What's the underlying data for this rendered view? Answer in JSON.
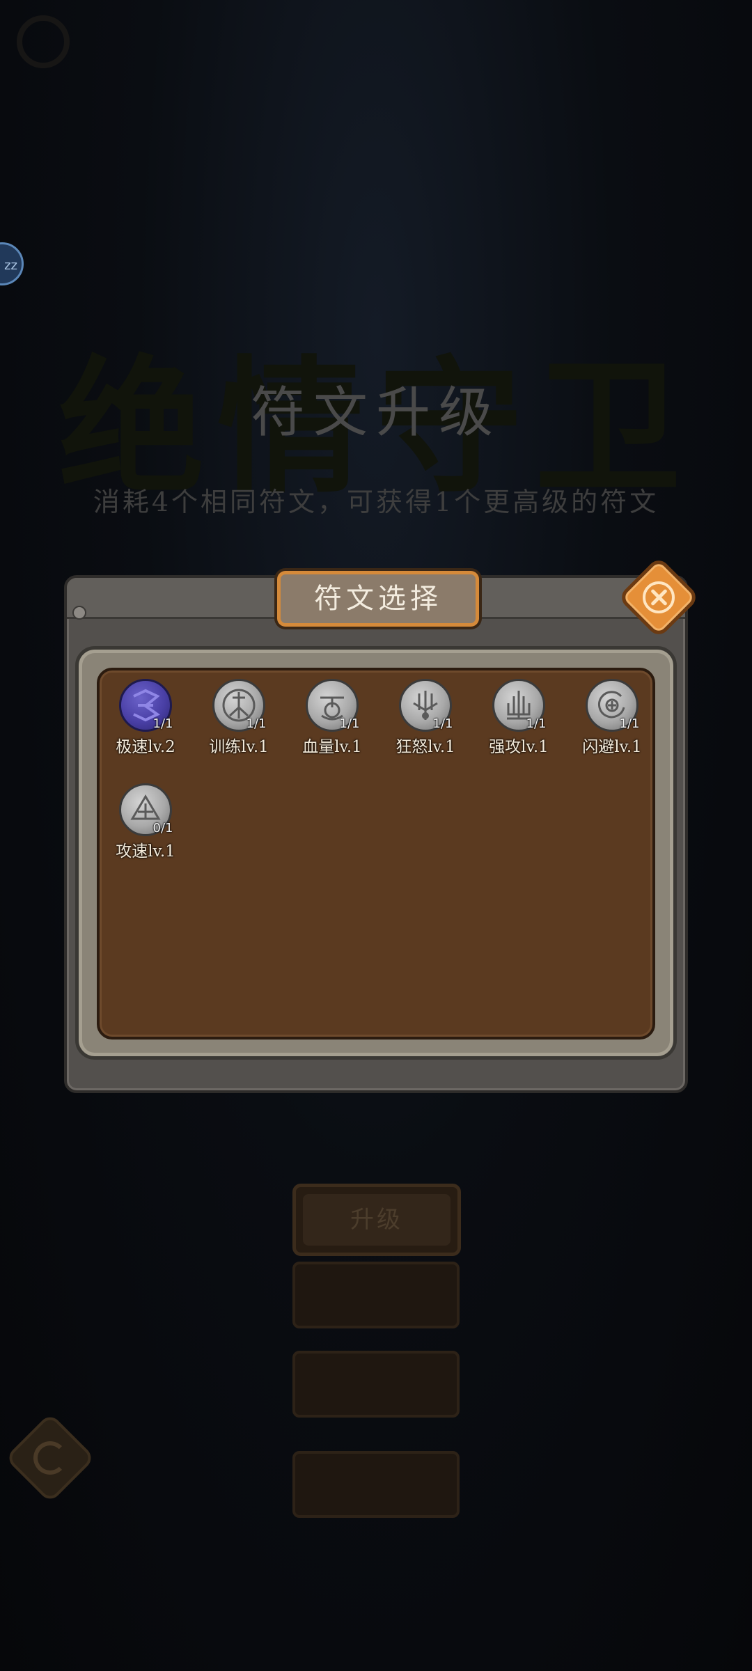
{
  "background": {
    "big_title": "绝情守卫",
    "title": "符文升级",
    "subtitle": "消耗4个相同符文，可获得1个更高级的符文",
    "upgrade_label": "升级",
    "badge": "zz"
  },
  "dialog": {
    "title": "符文选择",
    "runes": [
      {
        "name": "极速lv.2",
        "count": "1/1",
        "style": "purple",
        "icon": "rune-speed-icon"
      },
      {
        "name": "训练lv.1",
        "count": "1/1",
        "style": "silver",
        "icon": "rune-training-icon"
      },
      {
        "name": "血量lv.1",
        "count": "1/1",
        "style": "silver",
        "icon": "rune-health-icon"
      },
      {
        "name": "狂怒lv.1",
        "count": "1/1",
        "style": "silver",
        "icon": "rune-rage-icon"
      },
      {
        "name": "强攻lv.1",
        "count": "1/1",
        "style": "silver",
        "icon": "rune-assault-icon"
      },
      {
        "name": "闪避lv.1",
        "count": "1/1",
        "style": "silver",
        "icon": "rune-dodge-icon"
      },
      {
        "name": "攻速lv.1",
        "count": "0/1",
        "style": "silver",
        "icon": "rune-attack-speed-icon"
      }
    ]
  },
  "colors": {
    "accent_orange": "#e58f38",
    "panel_brown": "#5b3a20",
    "rune_purple": "#4a40a6"
  }
}
